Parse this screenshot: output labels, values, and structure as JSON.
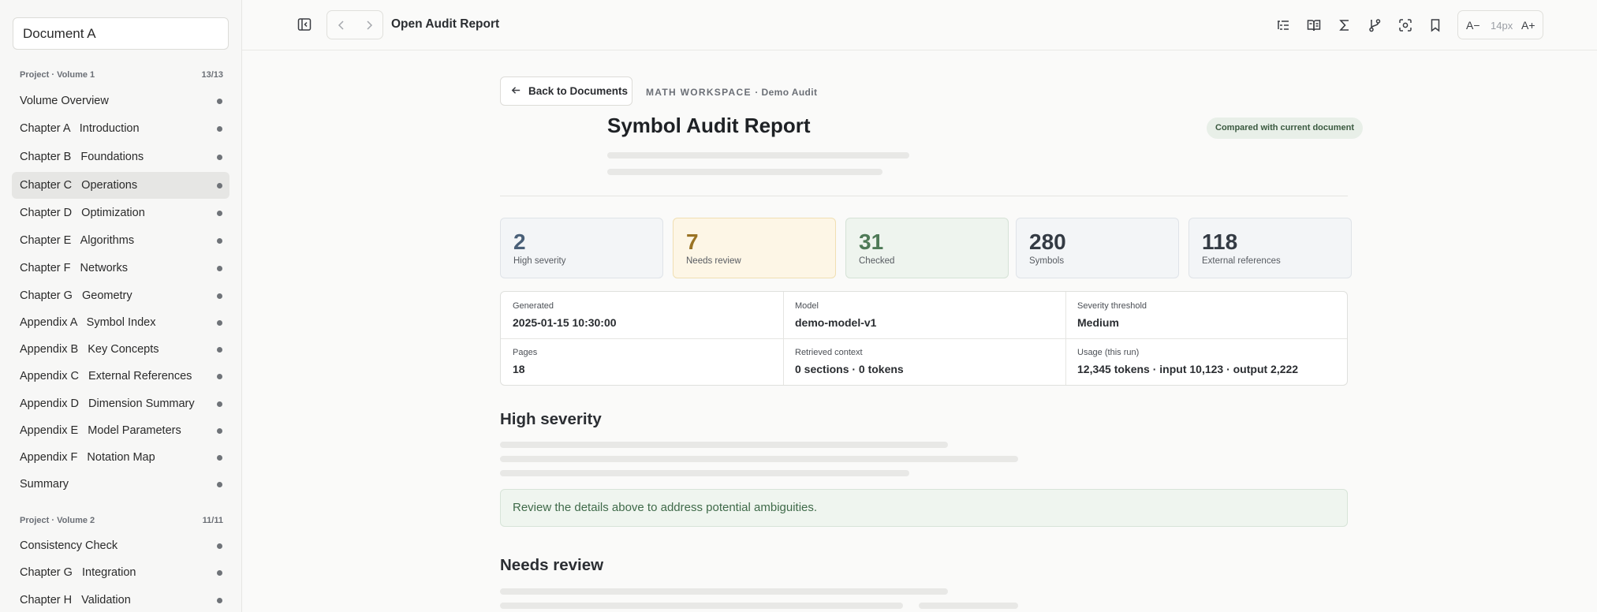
{
  "sidebar": {
    "document_selector": "Document A",
    "sections": [
      {
        "title": "Project · Volume 1",
        "count": "13/13",
        "items": [
          {
            "label": "Volume Overview"
          },
          {
            "label": "Chapter A   Introduction"
          },
          {
            "label": "Chapter B   Foundations"
          },
          {
            "label": "Chapter C   Operations",
            "active": true
          },
          {
            "label": "Chapter D   Optimization"
          },
          {
            "label": "Chapter E   Algorithms"
          },
          {
            "label": "Chapter F   Networks"
          },
          {
            "label": "Chapter G   Geometry"
          },
          {
            "label": "Appendix A   Symbol Index"
          },
          {
            "label": "Appendix B   Key Concepts"
          },
          {
            "label": "Appendix C   External References"
          },
          {
            "label": "Appendix D   Dimension Summary"
          },
          {
            "label": "Appendix E   Model Parameters"
          },
          {
            "label": "Appendix F   Notation Map"
          },
          {
            "label": "Summary"
          }
        ]
      },
      {
        "title": "Project · Volume 2",
        "count": "11/11",
        "items": [
          {
            "label": "Consistency Check"
          },
          {
            "label": "Chapter G   Integration"
          },
          {
            "label": "Chapter H   Validation"
          }
        ]
      }
    ]
  },
  "topbar": {
    "title": "Open Audit Report",
    "icons": [
      "sidebar-toggle-icon",
      "chevron-left-icon",
      "chevron-right-icon",
      "outline-list-icon",
      "book-open-icon",
      "sigma-icon",
      "branch-icon",
      "focus-icon",
      "bookmark-icon"
    ],
    "font_decrease": "A−",
    "font_size": "14px",
    "font_increase": "A+"
  },
  "main": {
    "back_label": "Back to Documents",
    "workspace": "MATH WORKSPACE",
    "workspace_sub": "· Demo Audit",
    "title": "Symbol Audit Report",
    "compare_badge": "Compared with current document",
    "stats": [
      {
        "value": "2",
        "label": "High severity",
        "color": "#4a6078"
      },
      {
        "value": "7",
        "label": "Needs review",
        "color": "#9a7324"
      },
      {
        "value": "31",
        "label": "Checked",
        "color": "#4f7a57"
      },
      {
        "value": "280",
        "label": "Symbols",
        "color": "#343b44"
      },
      {
        "value": "118",
        "label": "External references",
        "color": "#343b44"
      }
    ],
    "meta": {
      "generated_label": "Generated",
      "generated": "2025-01-15 10:30:00",
      "model_label": "Model",
      "model": "demo-model-v1",
      "threshold_label": "Severity threshold",
      "threshold": "Medium",
      "pages_label": "Pages",
      "pages": "18",
      "context_label": "Retrieved context",
      "context": "0 sections · 0 tokens",
      "usage_label": "Usage (this run)",
      "usage": "12,345 tokens · input 10,123 · output 2,222"
    },
    "section_high": "High severity",
    "notice": "Review the details above to address potential ambiguities.",
    "section_review": "Needs review"
  }
}
